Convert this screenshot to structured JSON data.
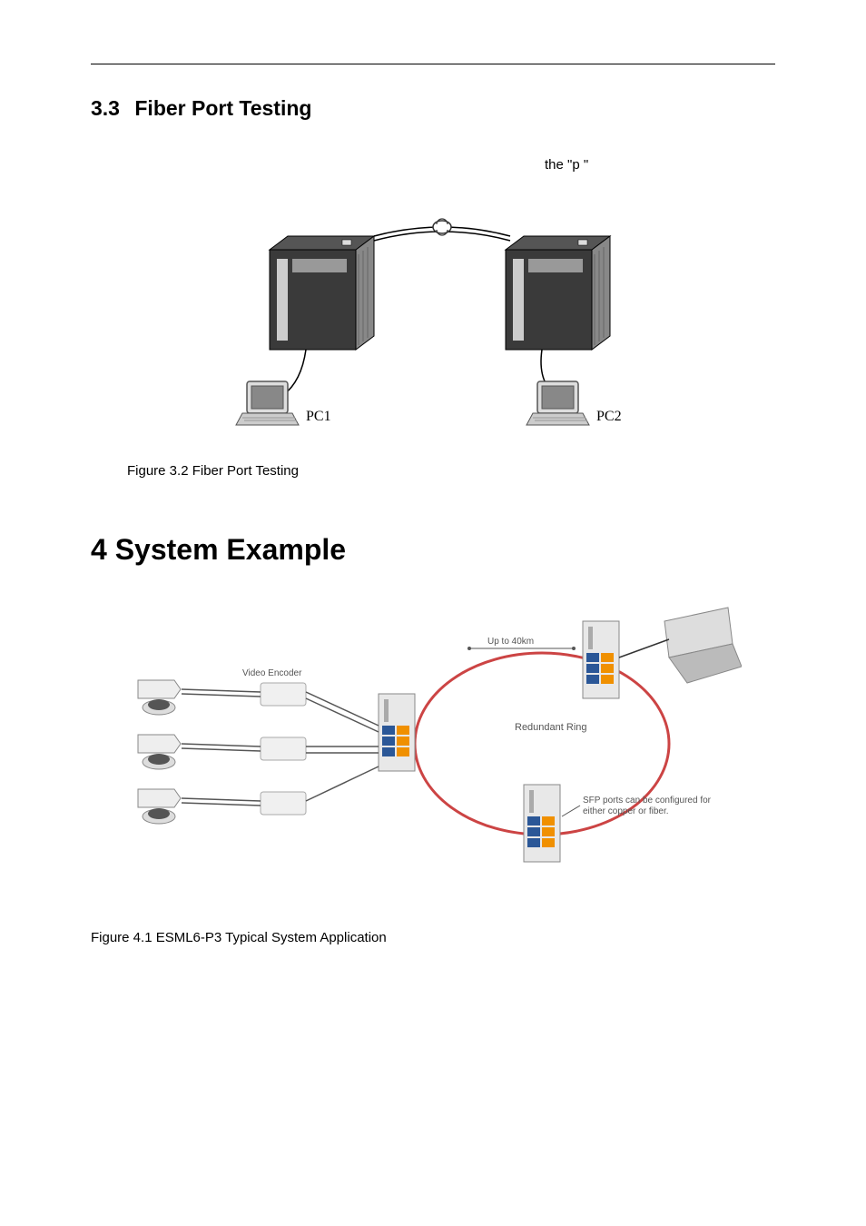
{
  "section_3_3": {
    "number": "3.3",
    "title": "Fiber Port Testing"
  },
  "body_fragment": "the \"p    \"",
  "figure_3_2": {
    "caption": "Figure 3.2 Fiber Port Testing",
    "labels": {
      "pc1": "PC1",
      "pc2": "PC2"
    }
  },
  "chapter_4": {
    "number": "4",
    "title": "System Example"
  },
  "figure_4_1": {
    "caption": "Figure 4.1 ESML6-P3 Typical System Application",
    "labels": {
      "video_encoder": "Video Encoder",
      "up_to_40km": "Up to 40km",
      "redundant_ring": "Redundant Ring",
      "sfp_note": "SFP ports can be configured for either copper or fiber."
    }
  }
}
